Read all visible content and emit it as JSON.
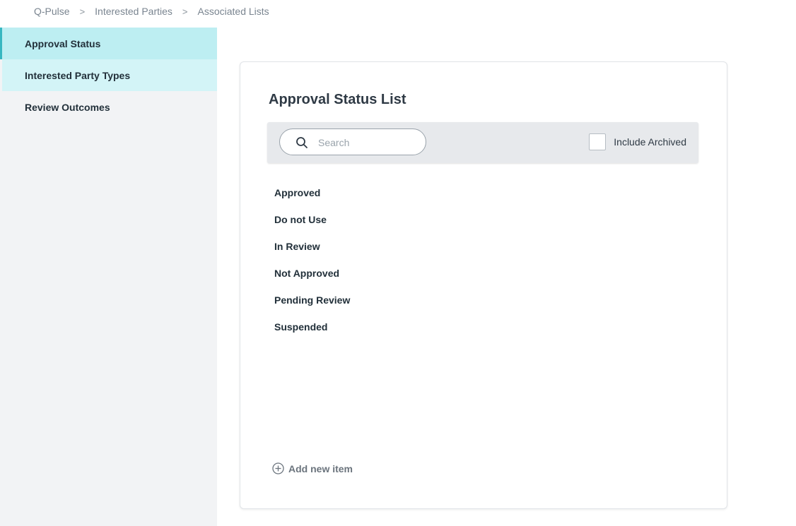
{
  "breadcrumb": {
    "items": [
      "Q-Pulse",
      "Interested Parties",
      "Associated Lists"
    ],
    "separator": ">"
  },
  "sidebar": {
    "items": [
      {
        "label": "Approval Status",
        "state": "active"
      },
      {
        "label": "Interested Party Types",
        "state": "hover"
      },
      {
        "label": "Review Outcomes",
        "state": "normal"
      }
    ]
  },
  "main": {
    "title": "Approval Status List",
    "search": {
      "placeholder": "Search",
      "value": ""
    },
    "include_archived": {
      "label": "Include Archived",
      "checked": false
    },
    "items": [
      "Approved",
      "Do not Use",
      "In Review",
      "Not Approved",
      "Pending Review",
      "Suspended"
    ],
    "add_item_label": "Add new item"
  },
  "icons": {
    "search": "search-icon",
    "add": "plus-circle-icon",
    "breadcrumb_separator": "chevron-right-icon"
  },
  "colors": {
    "active_item_bg": "#bdeef2",
    "active_item_accent": "#37b7c1",
    "hover_item_bg": "#d3f4f7",
    "sidebar_bg": "#f2f3f5",
    "toolbar_bg": "#e7e9ec"
  }
}
